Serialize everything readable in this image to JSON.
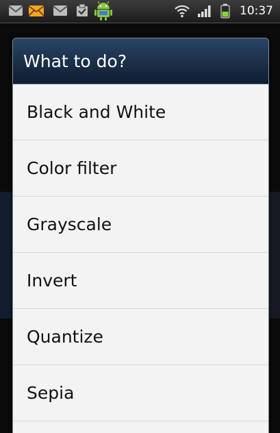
{
  "status_bar": {
    "time": "10:37",
    "notification_icons": [
      "gmail-icon",
      "email-icon",
      "gmail-icon",
      "task-icon",
      "android-icon"
    ],
    "system_icons": [
      "wifi-icon",
      "signal-icon",
      "battery-icon"
    ]
  },
  "dialog": {
    "title": "What to do?",
    "items": [
      {
        "label": "Black and White"
      },
      {
        "label": "Color filter"
      },
      {
        "label": "Grayscale"
      },
      {
        "label": "Invert"
      },
      {
        "label": "Quantize"
      },
      {
        "label": "Sepia"
      }
    ]
  },
  "colors": {
    "header_gradient_top": "#294566",
    "header_gradient_bottom": "#0f1d30",
    "list_background": "#f3f3f3",
    "battery_green": "#7bdc2a",
    "email_icon_orange": "#f5a623"
  }
}
